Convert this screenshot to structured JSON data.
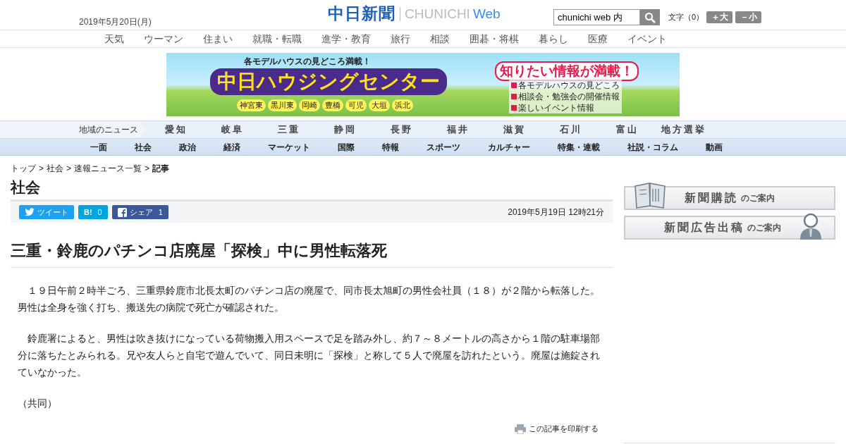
{
  "header": {
    "date": "2019年5月20日(月)",
    "logo": {
      "name": "中日新聞",
      "latin": "CHUNICHI",
      "web": "Web"
    },
    "search": {
      "value": "chunichi web 内"
    },
    "font_size": {
      "label": "文字（0）",
      "larger": "＋大",
      "smaller": "－小"
    }
  },
  "top_nav": [
    "天気",
    "ウーマン",
    "住まい",
    "就職・転職",
    "進学・教育",
    "旅行",
    "相談",
    "囲碁・将棋",
    "暮らし",
    "医療",
    "イベント"
  ],
  "banner": {
    "tagline": "各モデルハウスの見どころ満載！",
    "title": "中日ハウジングセンター",
    "places": [
      "神宮東",
      "黒川東",
      "岡崎",
      "豊橋",
      "可児",
      "大垣",
      "浜北"
    ],
    "headline": "知りたい情報が満載！",
    "points": [
      "各モデルハウスの見どころ",
      "相談会・勉強会の開催情報",
      "楽しいイベント情報"
    ]
  },
  "region_nav": {
    "label": "地域のニュース",
    "items": [
      "愛知",
      "岐阜",
      "三重",
      "静岡",
      "長野",
      "福井",
      "滋賀",
      "石川",
      "富山",
      "地方選挙"
    ]
  },
  "category_nav": [
    "一面",
    "社会",
    "政治",
    "経済",
    "マーケット",
    "国際",
    "特報",
    "スポーツ",
    "カルチャー",
    "特集・連載",
    "社説・コラム",
    "動画"
  ],
  "breadcrumb": [
    {
      "kind": "link",
      "label": "トップ"
    },
    {
      "kind": "separator",
      "label": ">"
    },
    {
      "kind": "link",
      "label": "社会"
    },
    {
      "kind": "separator",
      "label": ">"
    },
    {
      "kind": "link",
      "label": "速報ニュース一覧"
    },
    {
      "kind": "separator",
      "label": ">"
    },
    {
      "kind": "current",
      "label": "記事"
    }
  ],
  "section_title": "社会",
  "share": [
    {
      "kind": "twitter",
      "label": "ツイート"
    },
    {
      "kind": "hatena",
      "label": "B!",
      "count": "0"
    },
    {
      "kind": "facebook",
      "label": "シェア",
      "count": "1"
    }
  ],
  "timestamp": "2019年5月19日 12時21分",
  "article": {
    "headline": "三重・鈴鹿のパチンコ店廃屋「探検」中に男性転落死",
    "paragraphs": [
      "　１９日午前２時半ごろ、三重県鈴鹿市北長太町のパチンコ店の廃屋で、同市長太旭町の男性会社員（１８）が２階から転落した。男性は全身を強く打ち、搬送先の病院で死亡が確認された。",
      "　鈴鹿署によると、男性は吹き抜けになっている荷物搬入用スペースで足を踏み外し、約７～８メートルの高さから１階の駐車場部分に落ちたとみられる。兄や友人らと自宅で遊んでいて、同日未明に「探検」と称して５人で廃屋を訪れたという。廃屋は施錠されていなかった。",
      "（共同）"
    ],
    "print": "この記事を印刷する"
  },
  "sidebar": [
    {
      "kind": "book",
      "main": "新聞購読",
      "sub": "のご案内"
    },
    {
      "kind": "person",
      "main": "新聞広告出稿",
      "sub": "のご案内"
    }
  ]
}
